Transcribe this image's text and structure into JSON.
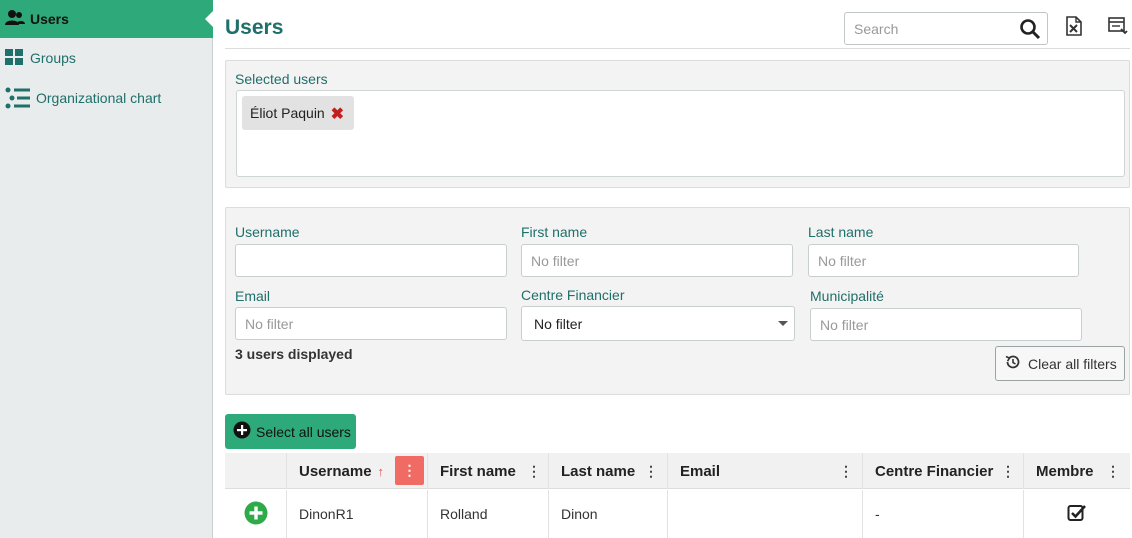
{
  "sidebar": {
    "items": [
      {
        "label": "Users",
        "icon": "users-icon"
      },
      {
        "label": "Groups",
        "icon": "groups-icon"
      },
      {
        "label": "Organizational chart",
        "icon": "org-chart-icon"
      }
    ]
  },
  "header": {
    "title": "Users",
    "search_placeholder": "Search"
  },
  "selected": {
    "label": "Selected users",
    "chips": [
      {
        "name": "Éliot Paquin"
      }
    ]
  },
  "filters": {
    "username": {
      "label": "Username",
      "value": ""
    },
    "first_name": {
      "label": "First name",
      "placeholder": "No filter"
    },
    "last_name": {
      "label": "Last name",
      "placeholder": "No filter"
    },
    "email": {
      "label": "Email",
      "placeholder": "No filter"
    },
    "centre": {
      "label": "Centre Financier",
      "value": "No filter"
    },
    "municipalite": {
      "label": "Municipalité",
      "placeholder": "No filter"
    },
    "count_text": "3 users displayed",
    "clear_label": "Clear all filters"
  },
  "actions": {
    "select_all_label": "Select all users"
  },
  "table": {
    "columns": [
      "Username",
      "First name",
      "Last name",
      "Email",
      "Centre Financier",
      "Membre"
    ],
    "rows": [
      {
        "username": "DinonR1",
        "first_name": "Rolland",
        "last_name": "Dinon",
        "email": "",
        "centre": "-",
        "membre": true
      }
    ]
  },
  "colors": {
    "accent": "#2eaa7a",
    "title": "#1f6f6a",
    "sort_active": "#ef6b63",
    "remove": "#c0211f"
  }
}
